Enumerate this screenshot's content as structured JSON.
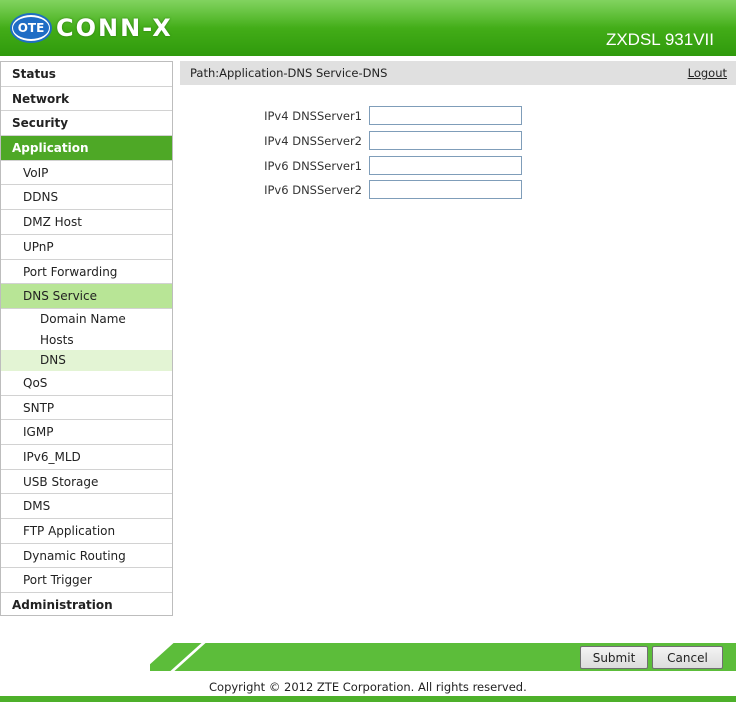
{
  "header": {
    "logo_badge": "OTE",
    "logo_text": "CONN-X",
    "model": "ZXDSL 931VII",
    "color": "#41ab17"
  },
  "sidebar": {
    "items": [
      {
        "label": "Status",
        "level": "top"
      },
      {
        "label": "Network",
        "level": "top"
      },
      {
        "label": "Security",
        "level": "top"
      },
      {
        "label": "Application",
        "level": "top",
        "active": true
      },
      {
        "label": "VoIP",
        "level": "sub"
      },
      {
        "label": "DDNS",
        "level": "sub"
      },
      {
        "label": "DMZ Host",
        "level": "sub"
      },
      {
        "label": "UPnP",
        "level": "sub"
      },
      {
        "label": "Port Forwarding",
        "level": "sub"
      },
      {
        "label": "DNS Service",
        "level": "sub",
        "active": true
      },
      {
        "label": "Domain Name",
        "level": "sub2"
      },
      {
        "label": "Hosts",
        "level": "sub2"
      },
      {
        "label": "DNS",
        "level": "sub2",
        "active": true
      },
      {
        "label": "QoS",
        "level": "sub"
      },
      {
        "label": "SNTP",
        "level": "sub"
      },
      {
        "label": "IGMP",
        "level": "sub"
      },
      {
        "label": "IPv6_MLD",
        "level": "sub"
      },
      {
        "label": "USB Storage",
        "level": "sub"
      },
      {
        "label": "DMS",
        "level": "sub"
      },
      {
        "label": "FTP Application",
        "level": "sub"
      },
      {
        "label": "Dynamic Routing",
        "level": "sub"
      },
      {
        "label": "Port Trigger",
        "level": "sub"
      },
      {
        "label": "Administration",
        "level": "top"
      }
    ]
  },
  "pathbar": {
    "path": "Path:Application-DNS Service-DNS",
    "logout": "Logout"
  },
  "form": {
    "fields": [
      {
        "label": "IPv4 DNSServer1",
        "value": ""
      },
      {
        "label": "IPv4 DNSServer2",
        "value": ""
      },
      {
        "label": "IPv6 DNSServer1",
        "value": ""
      },
      {
        "label": "IPv6 DNSServer2",
        "value": ""
      }
    ]
  },
  "actions": {
    "submit": "Submit",
    "cancel": "Cancel"
  },
  "footer": {
    "copyright": "Copyright © 2012 ZTE Corporation. All rights reserved."
  }
}
